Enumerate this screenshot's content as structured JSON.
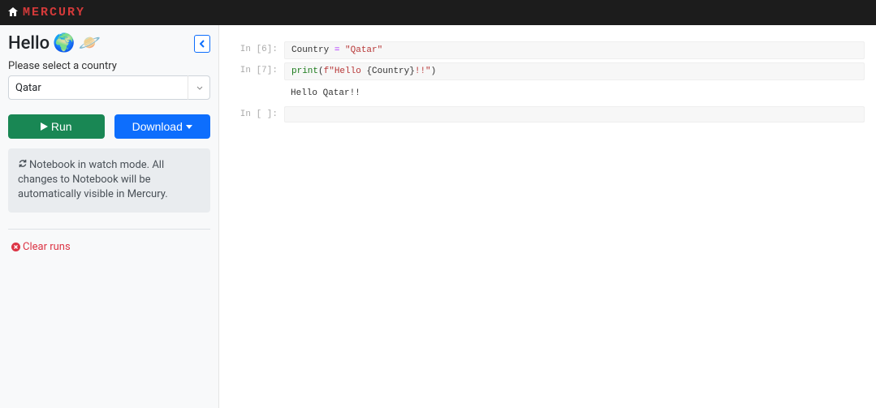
{
  "header": {
    "brand": "MERCURY"
  },
  "sidebar": {
    "title": "Hello",
    "emoji1": "🌍",
    "emoji2": "🪐",
    "select": {
      "label": "Please select a country",
      "value": "Qatar"
    },
    "run_label": "Run",
    "download_label": "Download",
    "info": "Notebook in watch mode. All changes to Notebook will be automatically visible in Mercury.",
    "clear_label": "Clear runs"
  },
  "cells": [
    {
      "prompt": "In [6]:",
      "input_parts": {
        "a": "Country",
        "b": " = ",
        "c": "\"Qatar\""
      },
      "output": null
    },
    {
      "prompt": "In [7]:",
      "input_parts": {
        "a": "print",
        "b": "(",
        "c": "f\"Hello ",
        "d": "{Country}",
        "e": "!!\"",
        "f": ")"
      },
      "output": "Hello Qatar!!"
    },
    {
      "prompt": "In [ ]:",
      "input_parts": {},
      "output": null
    }
  ]
}
